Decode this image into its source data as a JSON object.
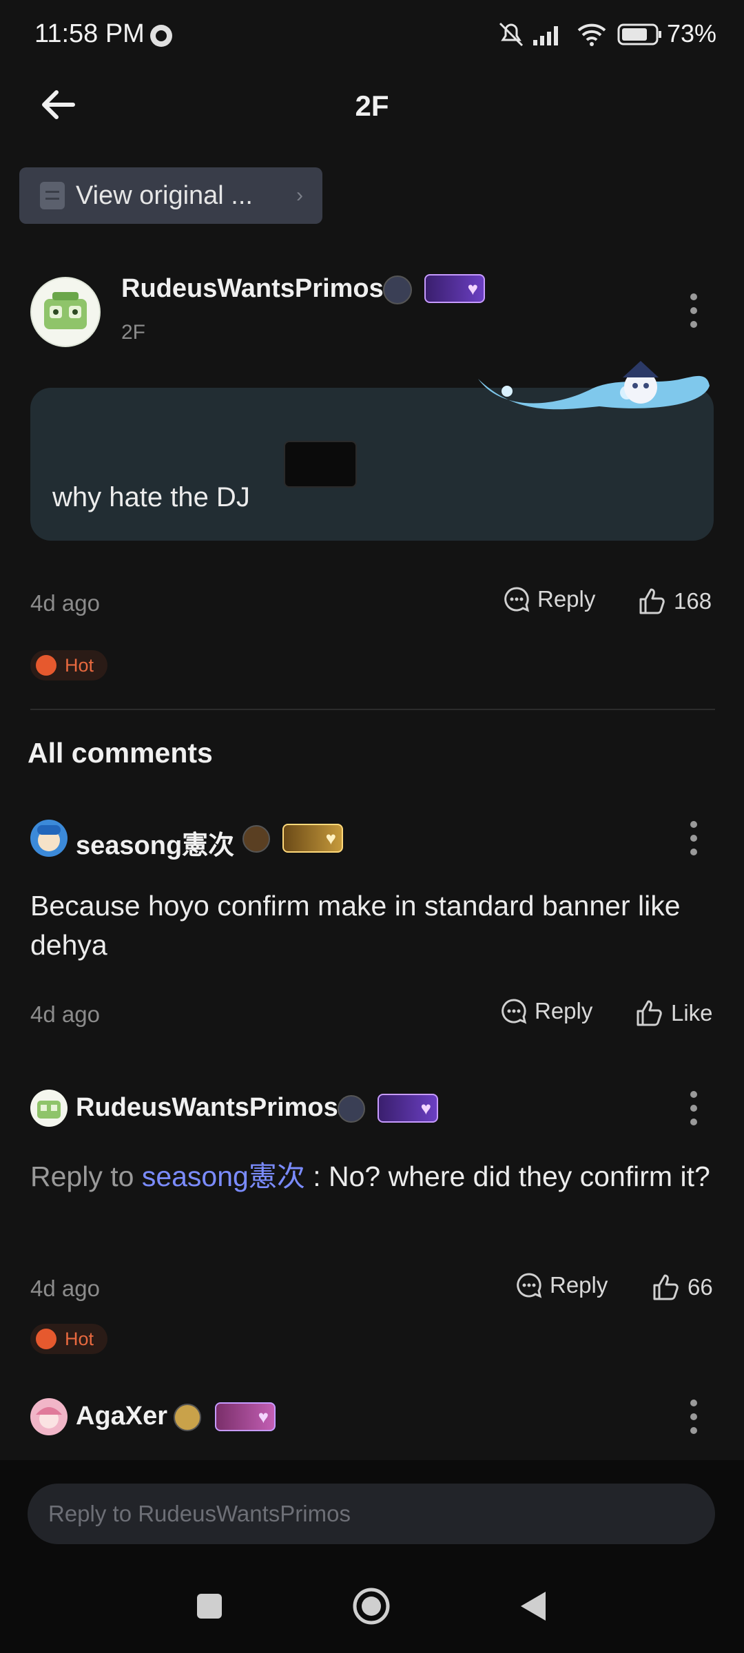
{
  "status_bar": {
    "time": "11:58 PM",
    "battery": "73%"
  },
  "header": {
    "title": "2F",
    "view_original": "View original ..."
  },
  "post": {
    "author": "RudeusWantsPrimos",
    "floor": "2F",
    "content": "why hate the DJ",
    "time": "4d ago",
    "reply_label": "Reply",
    "likes": "168",
    "hot_label": "Hot"
  },
  "section_title": "All comments",
  "comments": [
    {
      "author": "seasong憲次",
      "text": "Because hoyo confirm make in standard banner like dehya",
      "time": "4d ago",
      "reply_label": "Reply",
      "like_label": "Like"
    },
    {
      "author": "RudeusWantsPrimos",
      "reply_prefix": "Reply to ",
      "reply_to": "seasong憲次",
      "text": " : No? where did they confirm it?",
      "time": "4d ago",
      "reply_label": "Reply",
      "likes": "66",
      "hot_label": "Hot"
    },
    {
      "author": "AgaXer"
    }
  ],
  "reply_input": {
    "placeholder": "Reply to RudeusWantsPrimos"
  },
  "colors": {
    "background": "#131313",
    "bubble": "#222d33",
    "link": "#7b8cff",
    "hot": "#e8693f"
  }
}
